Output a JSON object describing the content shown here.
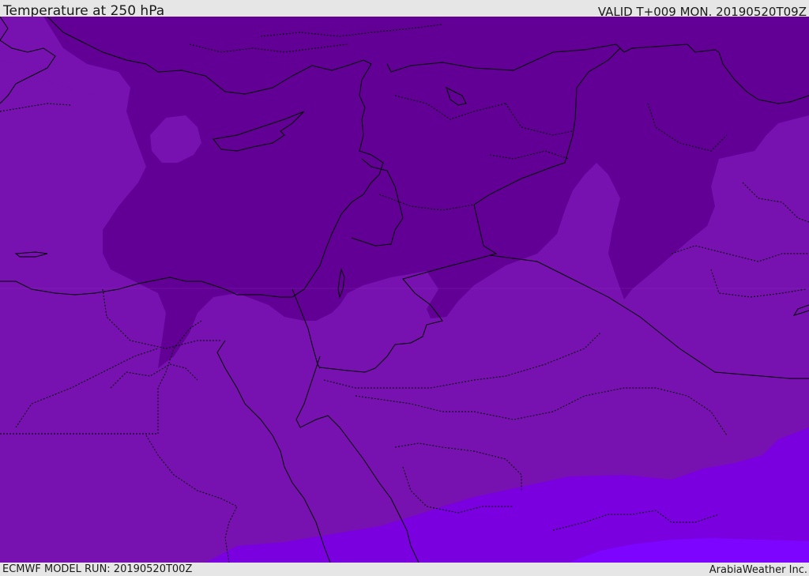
{
  "header": {
    "title": "Temperature at 250 hPa",
    "valid": "VALID T+009 MON. 20190520T09Z"
  },
  "footer": {
    "model_run": "ECMWF MODEL RUN: 20190520T00Z",
    "credit": "ArabiaWeather Inc."
  },
  "map": {
    "region": "Eastern Mediterranean and Arabian Peninsula",
    "field_colors": {
      "coldest": "#620096",
      "cold": "#7711b0",
      "mild": "#7a00e0",
      "warmest": "#7d05ff"
    },
    "coastline_color": "#000000",
    "border_style": "dotted"
  }
}
